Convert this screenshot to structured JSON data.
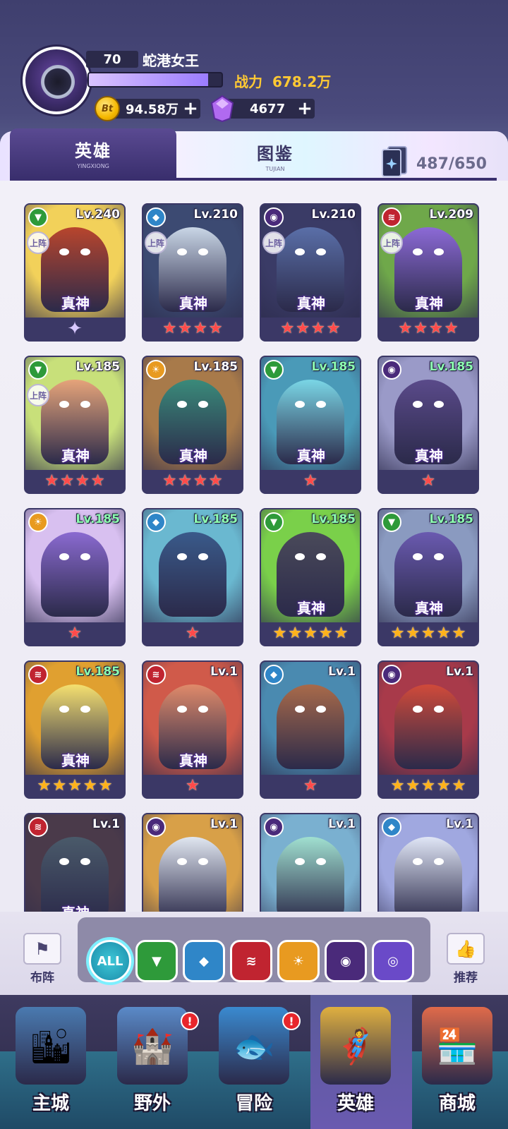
{
  "player": {
    "level": "70",
    "name": "蛇港女王",
    "xp_progress": 0.9,
    "power_label": "战力",
    "power_value": "678.2万",
    "gold": "94.58万",
    "gold_icon_text": "Bt",
    "gems": "4677",
    "plus": "+"
  },
  "tabs": [
    {
      "label": "英雄",
      "sub": "YINGXIONG",
      "active": true
    },
    {
      "label": "图鉴",
      "sub": "TUJIAN",
      "active": false
    }
  ],
  "collection_count": "487/650",
  "on_field_label": "上阵",
  "zhenshen_label": "真神",
  "heroes": [
    {
      "level": "Lv.240",
      "element": "wood",
      "on_field": true,
      "zhenshen": true,
      "stars": 0,
      "star_color": "crest",
      "bg": "#f2d15a",
      "char": "#b8452d"
    },
    {
      "level": "Lv.210",
      "element": "water",
      "on_field": true,
      "zhenshen": true,
      "stars": 4,
      "star_color": "red",
      "bg": "#3c4a72",
      "char": "#c9d6e6"
    },
    {
      "level": "Lv.210",
      "element": "shadow",
      "on_field": true,
      "zhenshen": true,
      "stars": 4,
      "star_color": "red",
      "bg": "#3a3b66",
      "char": "#5a6fa8"
    },
    {
      "level": "Lv.209",
      "element": "fire",
      "on_field": true,
      "zhenshen": true,
      "stars": 4,
      "star_color": "red",
      "bg": "#6fa84a",
      "char": "#8c6ad6"
    },
    {
      "level": "Lv.185",
      "element": "wood",
      "on_field": true,
      "zhenshen": true,
      "stars": 4,
      "star_color": "red",
      "bg": "#c8e07a",
      "char": "#e6a47a"
    },
    {
      "level": "Lv.185",
      "element": "light",
      "on_field": false,
      "zhenshen": true,
      "stars": 4,
      "star_color": "red",
      "bg": "#a87a4a",
      "char": "#3a8a7a"
    },
    {
      "level": "Lv.185",
      "element": "wood",
      "on_field": false,
      "zhenshen": true,
      "stars": 1,
      "star_color": "red",
      "bg": "#4a9ab8",
      "char": "#7ad6e6"
    },
    {
      "level": "Lv.185",
      "element": "shadow",
      "on_field": false,
      "zhenshen": true,
      "stars": 1,
      "star_color": "red",
      "bg": "#9a9ac8",
      "char": "#5a4a8a"
    },
    {
      "level": "Lv.185",
      "element": "light",
      "on_field": false,
      "zhenshen": false,
      "stars": 1,
      "star_color": "red",
      "bg": "#d8c0f0",
      "char": "#8a6ad0"
    },
    {
      "level": "Lv.185",
      "element": "water",
      "on_field": false,
      "zhenshen": false,
      "stars": 1,
      "star_color": "red",
      "bg": "#6ab8d0",
      "char": "#3a5a8a"
    },
    {
      "level": "Lv.185",
      "element": "wood",
      "on_field": false,
      "zhenshen": true,
      "stars": 5,
      "star_color": "gold",
      "bg": "#7ad04a",
      "char": "#4a4a5a"
    },
    {
      "level": "Lv.185",
      "element": "wood",
      "on_field": false,
      "zhenshen": true,
      "stars": 5,
      "star_color": "gold",
      "bg": "#8a9ac0",
      "char": "#6a5ab0"
    },
    {
      "level": "Lv.185",
      "element": "fire",
      "on_field": false,
      "zhenshen": true,
      "stars": 5,
      "star_color": "gold",
      "bg": "#e0a030",
      "char": "#f5e070"
    },
    {
      "level": "Lv.1",
      "element": "fire",
      "on_field": false,
      "zhenshen": true,
      "stars": 1,
      "star_color": "red",
      "bg": "#d05a4a",
      "char": "#e08a6a"
    },
    {
      "level": "Lv.1",
      "element": "water",
      "on_field": false,
      "zhenshen": false,
      "stars": 1,
      "star_color": "red",
      "bg": "#4a8ab0",
      "char": "#a86a4a"
    },
    {
      "level": "Lv.1",
      "element": "shadow",
      "on_field": false,
      "zhenshen": false,
      "stars": 5,
      "star_color": "gold",
      "bg": "#a83a4a",
      "char": "#d04a3a"
    },
    {
      "level": "Lv.1",
      "element": "fire",
      "on_field": false,
      "zhenshen": true,
      "stars": 0,
      "star_color": "red",
      "bg": "#4a3a4a",
      "char": "#4a5a6a"
    },
    {
      "level": "Lv.1",
      "element": "shadow",
      "on_field": false,
      "zhenshen": false,
      "stars": 0,
      "star_color": "red",
      "bg": "#d8a048",
      "char": "#e0e6f0"
    },
    {
      "level": "Lv.1",
      "element": "shadow",
      "on_field": false,
      "zhenshen": false,
      "stars": 0,
      "star_color": "red",
      "bg": "#7ab0d0",
      "char": "#a0e0d0"
    },
    {
      "level": "Lv.1",
      "element": "water",
      "on_field": false,
      "zhenshen": false,
      "stars": 0,
      "star_color": "red",
      "bg": "#a0a8e0",
      "char": "#e0e6f6"
    }
  ],
  "elements": {
    "wood": {
      "color": "#2e9a3a",
      "glyph": "▼",
      "icon": "wood-element-icon"
    },
    "water": {
      "color": "#2f86c8",
      "glyph": "◆",
      "icon": "water-element-icon"
    },
    "shadow": {
      "color": "#4a2a7a",
      "glyph": "◉",
      "icon": "shadow-element-icon"
    },
    "fire": {
      "color": "#c02430",
      "glyph": "≋",
      "icon": "fire-element-icon"
    },
    "light": {
      "color": "#e89a20",
      "glyph": "☀",
      "icon": "light-element-icon"
    },
    "arcane": {
      "color": "#6a4ac8",
      "glyph": "◎",
      "icon": "arcane-element-icon"
    }
  },
  "filter": {
    "left_button": "布阵",
    "right_button": "推荐",
    "all_label": "ALL",
    "options": [
      "wood",
      "water",
      "fire",
      "light",
      "shadow",
      "arcane"
    ]
  },
  "nav": [
    {
      "label": "主城",
      "icon": "city-icon",
      "alert": false,
      "active": false
    },
    {
      "label": "野外",
      "icon": "field-icon",
      "alert": true,
      "active": false
    },
    {
      "label": "冒险",
      "icon": "adventure-icon",
      "alert": true,
      "active": false
    },
    {
      "label": "英雄",
      "icon": "hero-icon",
      "alert": false,
      "active": true
    },
    {
      "label": "商城",
      "icon": "shop-icon",
      "alert": false,
      "active": false
    }
  ],
  "alert_mark": "!",
  "colors": {
    "accent": "#3b3866",
    "power": "#ffc933",
    "star_red": "#ff4a4a",
    "star_gold": "#ffb21a"
  }
}
